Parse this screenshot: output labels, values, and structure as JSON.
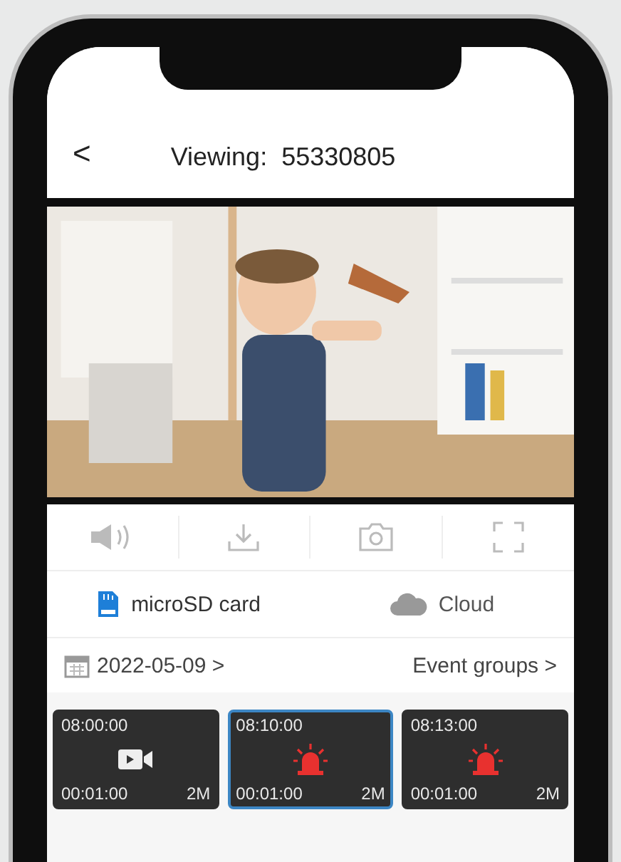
{
  "header": {
    "back": "<",
    "title": "Viewing:  55330805"
  },
  "toolbar": [
    {
      "kind": "speaker"
    },
    {
      "kind": "download"
    },
    {
      "kind": "camera"
    },
    {
      "kind": "fullscreen"
    }
  ],
  "sources": [
    {
      "label": "microSD card",
      "kind": "sdcard",
      "selected": true
    },
    {
      "label": "Cloud",
      "kind": "cloud",
      "selected": false
    }
  ],
  "date_row": {
    "date": "2022-05-09 >",
    "events": "Event groups >"
  },
  "clips": [
    {
      "start": "08:00:00",
      "duration": "00:01:00",
      "size": "2M",
      "kind": "video",
      "selected": false
    },
    {
      "start": "08:10:00",
      "duration": "00:01:00",
      "size": "2M",
      "kind": "alarm",
      "selected": true
    },
    {
      "start": "08:13:00",
      "duration": "00:01:00",
      "size": "2M",
      "kind": "alarm",
      "selected": false
    }
  ]
}
